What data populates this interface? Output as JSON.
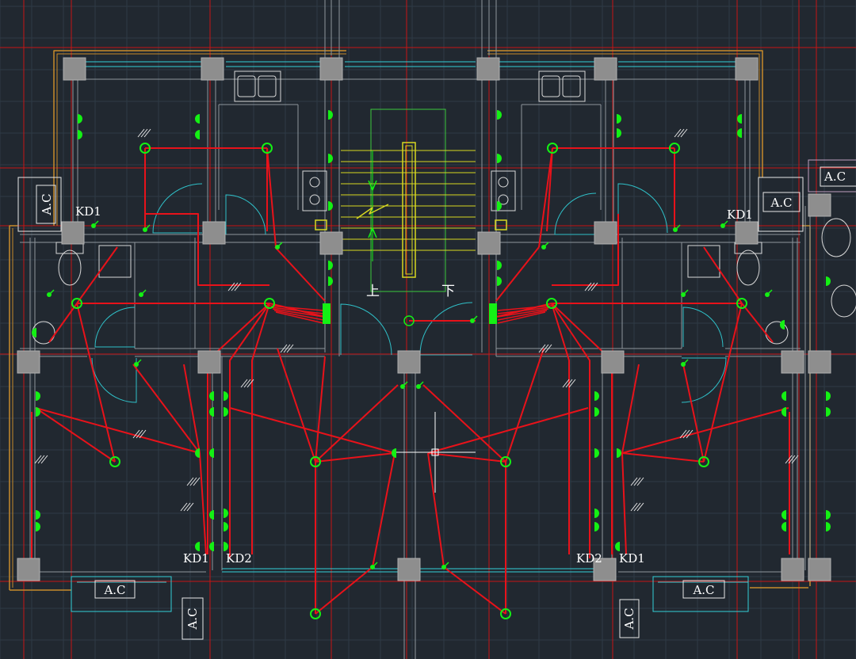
{
  "labels": {
    "ac": "A.C",
    "kd1": "KD1",
    "kd2": "KD2",
    "up": "上",
    "down": "下"
  },
  "colors": {
    "background": "#212830",
    "grid": "#2e3a46",
    "wall": "#8e969c",
    "column": "#8e8e8e",
    "wiring": "#e8121a",
    "fixture": "#14f014",
    "door": "#2fc0c8",
    "window": "#33d0d8",
    "axis": "#c81414",
    "outline": "#c88a2a",
    "stair": "#d8d820",
    "stair_frame": "#3cc83c",
    "text": "#ffffff"
  }
}
